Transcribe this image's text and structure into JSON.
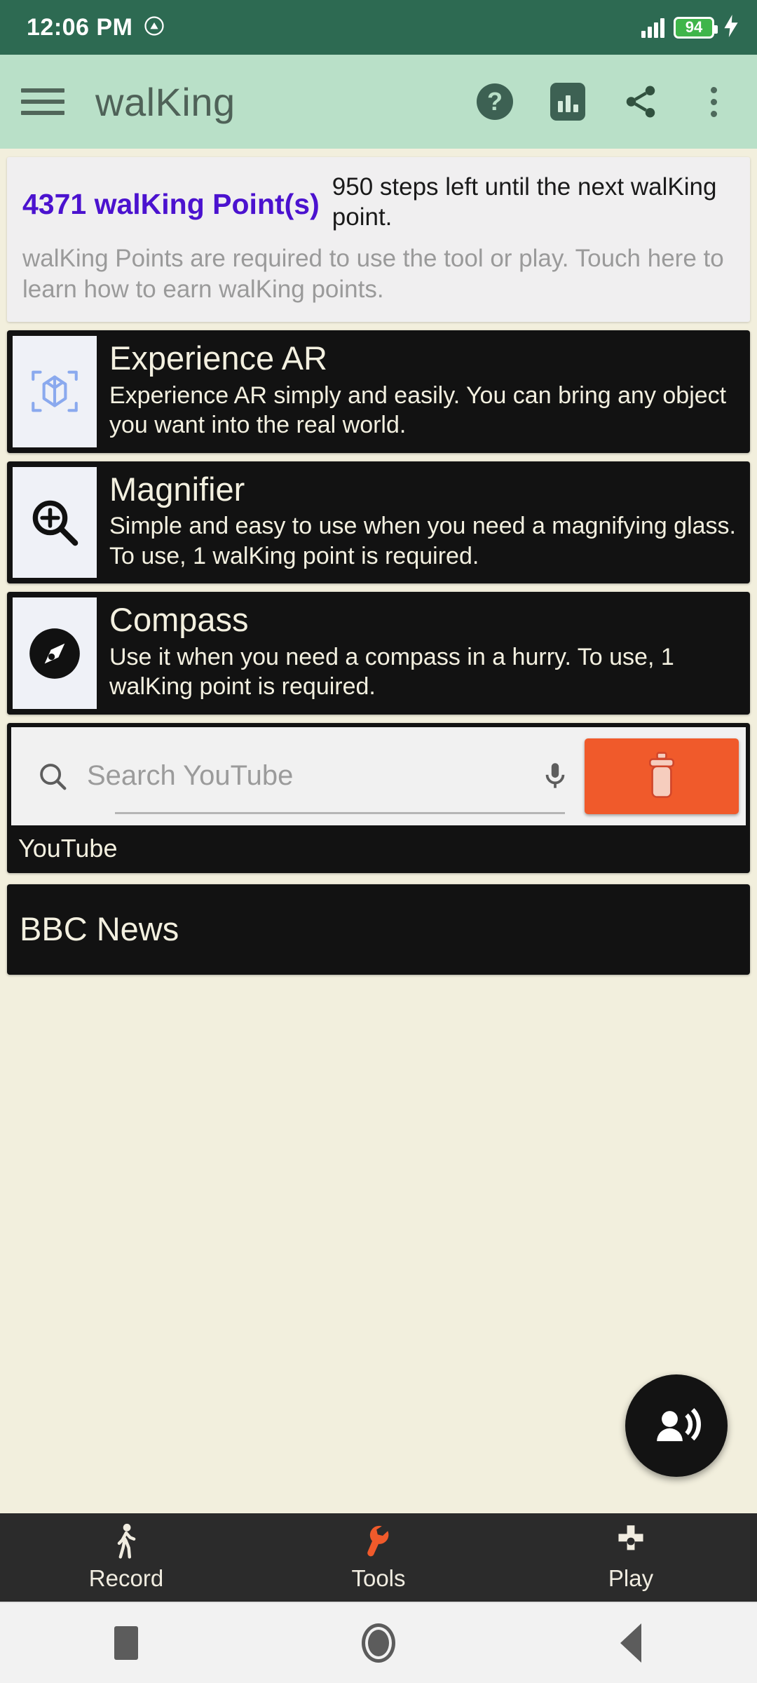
{
  "status_bar": {
    "time": "12:06 PM",
    "rotation_icon": "screen-rotation-lock-icon",
    "signal_icon": "cellular-signal-icon",
    "battery_level": "94",
    "charging_icon": "lightning-bolt-icon",
    "background": "#2d6a52"
  },
  "app_bar": {
    "menu_icon": "hamburger-menu-icon",
    "title": "walKing",
    "help_icon_label": "?",
    "stats_icon": "bar-chart-icon",
    "share_icon": "share-icon",
    "overflow_icon": "more-vertical-icon",
    "background": "#b9e0c8"
  },
  "points_card": {
    "points_value": "4371 walKing Point(s)",
    "steps_left": "950 steps left until the next walKing point.",
    "description": "walKing Points are required to use the tool or play. Touch here to learn how to earn walKing points.",
    "points_color": "#4b12cf"
  },
  "tools": [
    {
      "icon": "ar-cube-icon",
      "title": "Experience AR",
      "description": "Experience AR simply and easily. You can bring any object you want into the real world."
    },
    {
      "icon": "magnifier-plus-icon",
      "title": "Magnifier",
      "description": "Simple and easy to use when you need a magnifying glass. To use, 1 walKing point is required."
    },
    {
      "icon": "compass-icon",
      "title": "Compass",
      "description": "Use it when you need a compass in a hurry. To use, 1 walKing point is required."
    }
  ],
  "youtube_card": {
    "search_icon": "search-icon",
    "search_value": "",
    "search_placeholder": "Search YouTube",
    "mic_icon": "microphone-icon",
    "delete_icon": "trash-icon",
    "delete_button_color": "#f05a2b",
    "label": "YouTube"
  },
  "news_card": {
    "title": "BBC News"
  },
  "fab": {
    "icon": "voice-announcement-icon"
  },
  "bottom_nav": {
    "items": [
      {
        "icon": "walking-person-icon",
        "label": "Record",
        "active": false
      },
      {
        "icon": "wrench-icon",
        "label": "Tools",
        "active": true
      },
      {
        "icon": "gamepad-dpad-icon",
        "label": "Play",
        "active": false
      }
    ],
    "active_color": "#f05a2b",
    "background": "#2b2b2b"
  },
  "android_nav": {
    "recents_icon": "square-recents-icon",
    "home_icon": "circle-home-icon",
    "back_icon": "triangle-back-icon"
  }
}
